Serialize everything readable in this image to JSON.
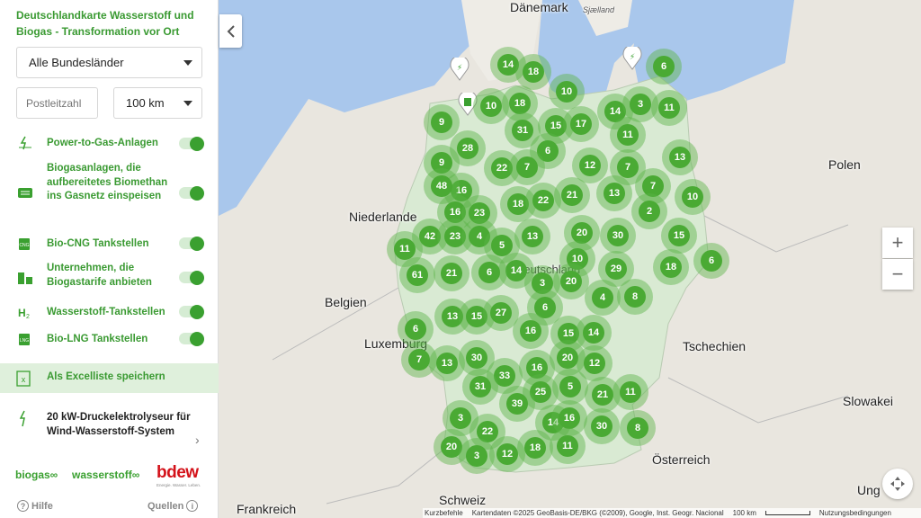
{
  "sidebar": {
    "title": "Deutschlandkarte Wasserstoff und Biogas - Transformation vor Ort",
    "state_select": "Alle Bundesländer",
    "postal_placeholder": "Postleitzahl",
    "radius_select": "100 km",
    "layers": [
      {
        "label": "Power-to-Gas-Anlagen",
        "icon": "power-to-gas-icon",
        "enabled": true
      },
      {
        "label": "Biogasanlagen, die aufbereitetes Biomethan ins Gasnetz einspeisen",
        "icon": "biogas-plant-icon",
        "enabled": true
      },
      {
        "label": "Bio-CNG Tankstellen",
        "icon": "cng-station-icon",
        "enabled": true
      },
      {
        "label": "Unternehmen, die Biogastarife anbieten",
        "icon": "company-icon",
        "enabled": true
      },
      {
        "label": "Wasserstoff-Tankstellen",
        "icon": "h2-station-icon",
        "enabled": true
      },
      {
        "label": "Bio-LNG Tankstellen",
        "icon": "lng-station-icon",
        "enabled": true
      }
    ],
    "excel_label": "Als Excelliste speichern",
    "feature_label": "20 kW-Druckelektrolyseur für Wind-Wasserstoff-System",
    "logos": {
      "biogas": "biogas",
      "wasserstoff": "wasserstoff",
      "bdew": "bdew",
      "bdew_sub": "Energie. Wasser. Leben."
    },
    "help": "Hilfe",
    "sources": "Quellen"
  },
  "map": {
    "labels": {
      "daenemark": "Dänemark",
      "sjaelland": "Sjælland",
      "polen": "Polen",
      "niederlande": "Niederlande",
      "belgien": "Belgien",
      "deutschland": "Deutschland",
      "luxemburg": "Luxemburg",
      "tschechien": "Tschechien",
      "slowakei": "Slowakei",
      "oesterreich": "Österreich",
      "frankreich": "Frankreich",
      "schweiz": "Schweiz",
      "ungarn": "Ung"
    },
    "clusters": [
      "14",
      "18",
      "6",
      "10",
      "10",
      "18",
      "14",
      "3",
      "11",
      "9",
      "15",
      "17",
      "31",
      "11",
      "6",
      "28",
      "9",
      "22",
      "7",
      "12",
      "7",
      "13",
      "16",
      "48",
      "7",
      "21",
      "18",
      "22",
      "13",
      "10",
      "16",
      "23",
      "2",
      "42",
      "23",
      "4",
      "5",
      "13",
      "20",
      "30",
      "15",
      "11",
      "10",
      "6",
      "29",
      "14",
      "18",
      "61",
      "21",
      "6",
      "3",
      "20",
      "4",
      "8",
      "6",
      "13",
      "15",
      "27",
      "6",
      "16",
      "15",
      "14",
      "7",
      "13",
      "30",
      "33",
      "16",
      "20",
      "12",
      "31",
      "25",
      "5",
      "21",
      "11",
      "39",
      "3",
      "14",
      "16",
      "30",
      "8",
      "22",
      "18",
      "11",
      "20",
      "3",
      "12"
    ],
    "attribution": {
      "shortcuts": "Kurzbefehle",
      "data": "Kartendaten ©2025 GeoBasis-DE/BKG (©2009), Google, Inst. Geogr. Nacional",
      "scale": "100 km",
      "terms": "Nutzungsbedingungen"
    },
    "zoom_in": "+",
    "zoom_out": "−"
  },
  "colors": {
    "accent": "#3aa030",
    "cluster_core": "#4aaa34",
    "cluster_halo": "#5cb448",
    "water": "#a9c7ec",
    "land": "#e9e6df"
  }
}
